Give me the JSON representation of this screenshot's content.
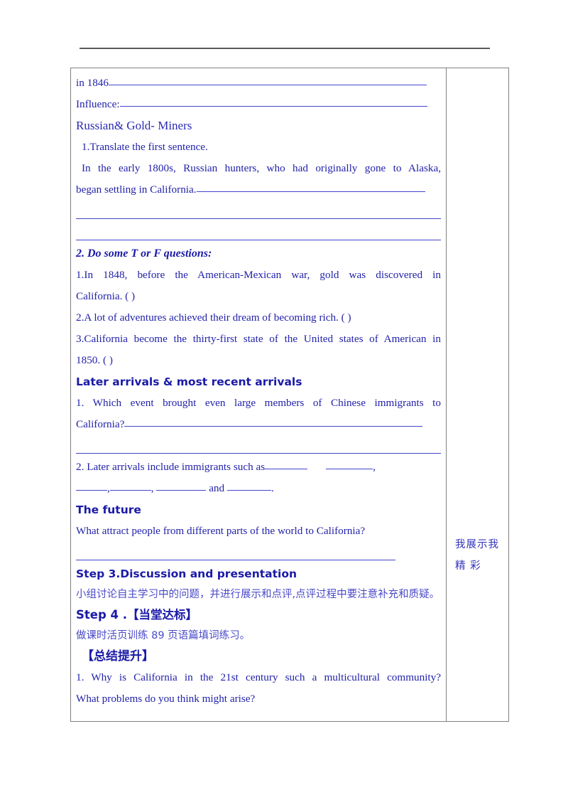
{
  "document": {
    "header_rule": true,
    "side_column": {
      "lines": [
        "我展示我",
        "精 彩"
      ]
    },
    "blocks": [
      {
        "id": "in1846",
        "text": "in 1846",
        "blank_after": true
      },
      {
        "id": "influence",
        "text": "Influence:",
        "blank_after": true
      },
      {
        "id": "russian_heading",
        "text": "Russian& Gold- Miners"
      },
      {
        "id": "task1",
        "text": "1.Translate the first sentence."
      },
      {
        "id": "sentence1a",
        "text": "In the early 1800s, Russian hunters, who had originally gone to Alaska,"
      },
      {
        "id": "sentence1b",
        "text": "began settling in California.",
        "blank_after": true
      },
      {
        "id": "tf_heading",
        "text": "2. Do some T or F questions:"
      },
      {
        "id": "tf1a",
        "text": "1.In 1848, before the American-Mexican war, gold was discovered in"
      },
      {
        "id": "tf1b",
        "text": "California.    (     )"
      },
      {
        "id": "tf2",
        "text": "2.A lot of adventures achieved their dream of becoming rich. (      )"
      },
      {
        "id": "tf3a",
        "text": "3.California become the thirty-first state of the United states of American in"
      },
      {
        "id": "tf3b",
        "text": "1850.     (      )"
      },
      {
        "id": "later_heading",
        "text": "Later arrivals & most recent arrivals"
      },
      {
        "id": "q1a",
        "text": "1. Which event brought even large members of Chinese immigrants to"
      },
      {
        "id": "q1b",
        "text": "California?",
        "blank_after": true
      },
      {
        "id": "q2a",
        "text": "2. Later arrivals include immigrants such as"
      },
      {
        "id": "q2b",
        "text": "and"
      },
      {
        "id": "future_heading",
        "text": "The future"
      },
      {
        "id": "future_q",
        "text": "What attract people from different parts of the world to California?"
      },
      {
        "id": "step3_heading",
        "text": "Step 3.Discussion and presentation"
      },
      {
        "id": "step3_cn",
        "text": "小组讨论自主学习中的问题，并进行展示和点评,点评过程中要注意补充和质疑。"
      },
      {
        "id": "step4_heading",
        "text": "Step 4 .【当堂达标】"
      },
      {
        "id": "step4_cn",
        "text": "做课时活页训练 89 页语篇填词练习。"
      },
      {
        "id": "summary_heading",
        "text": "【总结提升】"
      },
      {
        "id": "summary_q1",
        "text": "1. Why is California in the 21st century such a multicultural community?"
      },
      {
        "id": "summary_q2",
        "text": "What problems do you think might arise?"
      }
    ]
  },
  "colors": {
    "text_blue": "#2222aa",
    "heading_blue": "#1a1aa8",
    "rule_blue": "#4444cc",
    "border_gray": "#808080",
    "header_rule_gray": "#5a5a5a"
  }
}
